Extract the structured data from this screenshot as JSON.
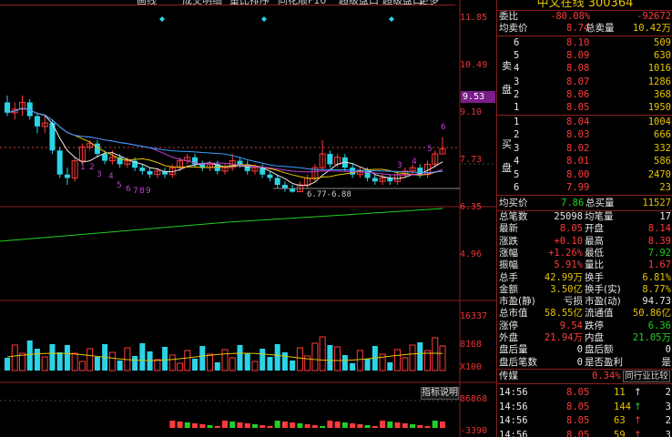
{
  "toolbar": {
    "items": [
      "画线",
      "成交明细",
      "量比排序",
      "同花顺F10",
      "超级盘口",
      "超级盘口",
      "更多"
    ]
  },
  "price_axis": [
    "11.85",
    "10.49",
    "9.10",
    "7.73",
    "6.35",
    "4.96"
  ],
  "current_price_tag": "9.53",
  "volume_axis": [
    "16337",
    "8168",
    "X100"
  ],
  "indicator_axis": [
    "86868",
    "-3390"
  ],
  "indicator_button": "指标说明",
  "range_label": "6.77-6.88",
  "candle_labels": {
    "magenta": [
      "1",
      "2",
      "3",
      "4",
      "5",
      "6",
      "7",
      "8",
      "9"
    ],
    "recent": [
      "3",
      "4",
      "5",
      "6"
    ]
  },
  "colors": {
    "up": "#ff3b3b",
    "down": "#2ad4e6",
    "ma_yellow": "#e7c400",
    "ma_white": "#e8e8e8",
    "ma_blue": "#3aa0ff",
    "ma_green": "#22d022",
    "magenta": "#c040d0"
  },
  "stock": {
    "title": "中文在线 300364"
  },
  "order_book": {
    "committee_label": "委比",
    "committee_ratio": "-80.08%",
    "committee_diff": "-92672",
    "avg_sell_label": "均卖价",
    "avg_sell_price": "8.74",
    "total_sell_label": "总卖量",
    "total_sell_vol": "10.42万",
    "sell_side_label": [
      "卖",
      "盘"
    ],
    "sells": [
      {
        "level": "6",
        "price": "8.10",
        "vol": "509"
      },
      {
        "level": "5",
        "price": "8.09",
        "vol": "630"
      },
      {
        "level": "4",
        "price": "8.08",
        "vol": "1016"
      },
      {
        "level": "3",
        "price": "8.07",
        "vol": "1286"
      },
      {
        "level": "2",
        "price": "8.06",
        "vol": "368"
      },
      {
        "level": "1",
        "price": "8.05",
        "vol": "1950"
      }
    ],
    "buy_side_label": [
      "买",
      "盘"
    ],
    "buys": [
      {
        "level": "1",
        "price": "8.04",
        "vol": "1004"
      },
      {
        "level": "2",
        "price": "8.03",
        "vol": "666"
      },
      {
        "level": "3",
        "price": "8.02",
        "vol": "332"
      },
      {
        "level": "4",
        "price": "8.01",
        "vol": "586"
      },
      {
        "level": "5",
        "price": "8.00",
        "vol": "2470"
      },
      {
        "level": "6",
        "price": "7.99",
        "vol": "23"
      }
    ],
    "avg_buy_label": "均买价",
    "avg_buy_price": "7.86",
    "total_buy_label": "总买量",
    "total_buy_vol": "11527"
  },
  "quote": [
    {
      "l1": "总笔数",
      "v1": "25098",
      "c1": "white",
      "l2": "均笔量",
      "v2": "17",
      "c2": "white"
    },
    {
      "l1": "最新",
      "v1": "8.05",
      "c1": "red",
      "l2": "开盘",
      "v2": "8.14",
      "c2": "red"
    },
    {
      "l1": "涨跌",
      "v1": "+0.10",
      "c1": "red",
      "l2": "最高",
      "v2": "8.39",
      "c2": "red"
    },
    {
      "l1": "涨幅",
      "v1": "+1.26%",
      "c1": "red",
      "l2": "最低",
      "v2": "7.92",
      "c2": "green"
    },
    {
      "l1": "振幅",
      "v1": "5.91%",
      "c1": "red",
      "l2": "量比",
      "v2": "1.67",
      "c2": "red"
    },
    {
      "l1": "总手",
      "v1": "42.99万",
      "c1": "yellow",
      "l2": "换手",
      "v2": "6.81%",
      "c2": "yellow"
    },
    {
      "l1": "金额",
      "v1": "3.50亿",
      "c1": "yellow",
      "l2": "换手(实)",
      "v2": "8.77%",
      "c2": "yellow"
    },
    {
      "l1": "市盈(静)",
      "v1": "亏损",
      "c1": "white",
      "l2": "市盈(动)",
      "v2": "94.73",
      "c2": "white"
    },
    {
      "l1": "总市值",
      "v1": "58.55亿",
      "c1": "yellow",
      "l2": "流通值",
      "v2": "50.86亿",
      "c2": "yellow"
    },
    {
      "l1": "涨停",
      "v1": "9.54",
      "c1": "red",
      "l2": "跌停",
      "v2": "6.36",
      "c2": "green"
    },
    {
      "l1": "外盘",
      "v1": "21.94万",
      "c1": "red",
      "l2": "内盘",
      "v2": "21.05万",
      "c2": "green"
    },
    {
      "l1": "盘后量",
      "v1": "0",
      "c1": "white",
      "l2": "盘后额",
      "v2": "0",
      "c2": "white"
    },
    {
      "l1": "盘后笔数",
      "v1": "0",
      "c1": "white",
      "l2": "是否盈利",
      "v2": "是",
      "c2": "white"
    }
  ],
  "industry": {
    "name": "传媒",
    "change": "0.34%",
    "peer_tab": "同行业比较"
  },
  "ticks": [
    {
      "time": "14:56",
      "price": "8.05",
      "vol": "11",
      "arrow": "↑",
      "arrow_color": "white",
      "count": "2"
    },
    {
      "time": "14:56",
      "price": "8.05",
      "vol": "144",
      "arrow": "↑",
      "arrow_color": "green",
      "count": "3"
    },
    {
      "time": "14:56",
      "price": "8.05",
      "vol": "63",
      "arrow": "↑",
      "arrow_color": "red",
      "count": "2"
    },
    {
      "time": "14:56",
      "price": "8.05",
      "vol": "59",
      "arrow": "↑",
      "arrow_color": "red",
      "count": "3"
    }
  ]
}
